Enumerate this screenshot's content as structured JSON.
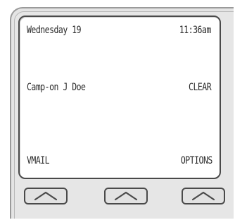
{
  "display": {
    "date": "Wednesday 19",
    "time": "11:36am",
    "call_status": "Camp-on J Doe",
    "action_right": "CLEAR",
    "softkey_left_label": "VMAIL",
    "softkey_right_label": "OPTIONS"
  },
  "softkeys": [
    {
      "icon": "up-arrow-icon"
    },
    {
      "icon": "up-arrow-icon"
    },
    {
      "icon": "up-arrow-icon"
    }
  ]
}
